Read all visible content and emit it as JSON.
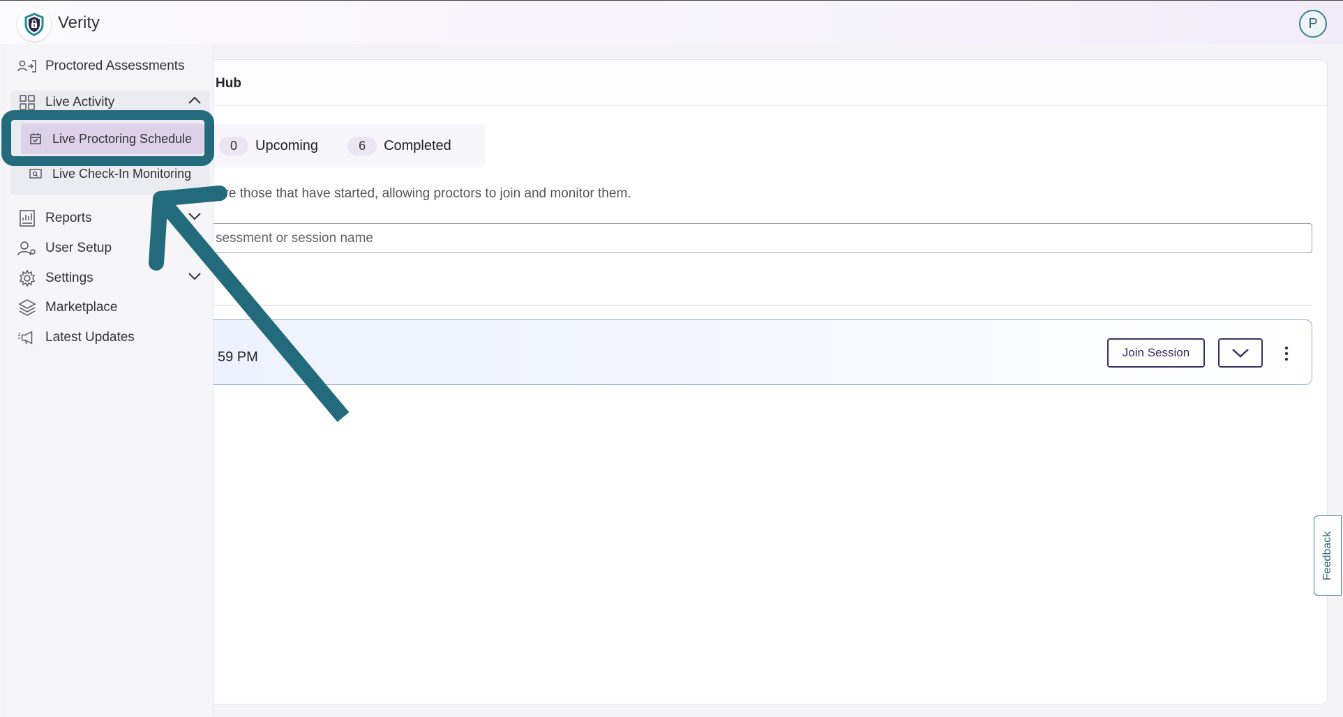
{
  "app": {
    "name": "Verity",
    "user_initial": "P"
  },
  "sidebar": {
    "items": [
      {
        "label": "Proctored Assessments",
        "icon": "proctored-assessments-icon"
      },
      {
        "label": "Live Activity",
        "icon": "grid-icon",
        "expanded": true
      },
      {
        "label": "Reports",
        "icon": "reports-icon"
      },
      {
        "label": "User Setup",
        "icon": "user-gear-icon"
      },
      {
        "label": "Settings",
        "icon": "gear-icon"
      },
      {
        "label": "Marketplace",
        "icon": "layers-icon"
      },
      {
        "label": "Latest Updates",
        "icon": "megaphone-icon"
      }
    ],
    "live_activity_sub": [
      {
        "label": "Live Proctoring Schedule",
        "icon": "calendar-check-icon",
        "active": true
      },
      {
        "label": "Live Check-In Monitoring",
        "icon": "monitor-search-icon",
        "active": false
      }
    ]
  },
  "main": {
    "title_visible": "Hub",
    "tabs": [
      {
        "count": "0",
        "label": "Upcoming"
      },
      {
        "count": "6",
        "label": "Completed"
      }
    ],
    "description_visible": "are those that have started, allowing proctors to join and monitor them.",
    "search_placeholder_visible": "sessment or session name",
    "section_label_visible": ":",
    "session": {
      "time_visible": "59 PM",
      "join_label": "Join Session"
    }
  },
  "feedback_label": "Feedback",
  "colors": {
    "accent_teal": "#236a7c",
    "brand_purple": "#3a2e60",
    "active_item_bg": "#ddd2ea"
  }
}
